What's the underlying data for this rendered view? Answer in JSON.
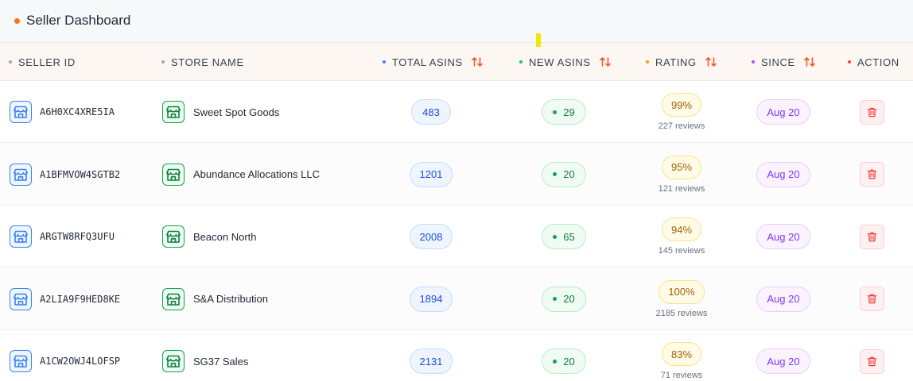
{
  "header": {
    "title": "Seller Dashboard",
    "dot_color": "#f97316"
  },
  "columns": [
    {
      "key": "seller_id",
      "label": "SELLER ID",
      "dot_color": "#a3a3b5",
      "sortable": false
    },
    {
      "key": "store_name",
      "label": "STORE NAME",
      "dot_color": "#a3a3b5",
      "sortable": false
    },
    {
      "key": "total_asins",
      "label": "TOTAL ASINS",
      "dot_color": "#3b82f6",
      "sortable": true
    },
    {
      "key": "new_asins",
      "label": "NEW ASINS",
      "dot_color": "#22c55e",
      "sortable": true
    },
    {
      "key": "rating",
      "label": "RATING",
      "dot_color": "#f59e0b",
      "sortable": true
    },
    {
      "key": "since",
      "label": "SINCE",
      "dot_color": "#a855f7",
      "sortable": true
    },
    {
      "key": "action",
      "label": "ACTION",
      "dot_color": "#ef4444",
      "sortable": false
    }
  ],
  "rows": [
    {
      "seller_id": "A6H0XC4XRE5IA",
      "store_name": "Sweet Spot Goods",
      "total_asins": "483",
      "new_asins": "29",
      "rating": "99%",
      "reviews": "227 reviews",
      "since": "Aug 20"
    },
    {
      "seller_id": "A1BFMVOW4SGTB2",
      "store_name": "Abundance Allocations LLC",
      "total_asins": "1201",
      "new_asins": "20",
      "rating": "95%",
      "reviews": "121 reviews",
      "since": "Aug 20"
    },
    {
      "seller_id": "ARGTW8RFQ3UFU",
      "store_name": "Beacon North",
      "total_asins": "2008",
      "new_asins": "65",
      "rating": "94%",
      "reviews": "145 reviews",
      "since": "Aug 20"
    },
    {
      "seller_id": "A2LIA9F9HED8KE",
      "store_name": "S&A Distribution",
      "total_asins": "1894",
      "new_asins": "20",
      "rating": "100%",
      "reviews": "2185 reviews",
      "since": "Aug 20"
    },
    {
      "seller_id": "A1CW2OWJ4LOFSP",
      "store_name": "SG37 Sales",
      "total_asins": "2131",
      "new_asins": "20",
      "rating": "83%",
      "reviews": "71 reviews",
      "since": "Aug 20"
    }
  ],
  "icons": {
    "seller": "storefront-icon",
    "store": "storefront-icon",
    "sort": "sort-arrows-icon",
    "delete": "trash-icon"
  },
  "colors": {
    "sort_arrows": "#f05a28",
    "delete": "#ef4444"
  }
}
